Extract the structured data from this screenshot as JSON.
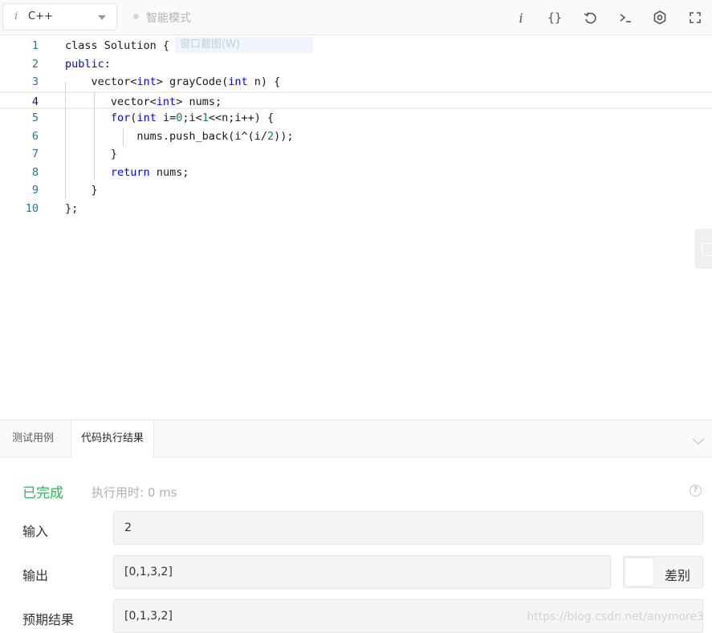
{
  "toolbar": {
    "language": "C++",
    "mode_label": "智能模式",
    "icons": [
      "info-icon",
      "format-braces-icon",
      "reset-icon",
      "console-icon",
      "settings-icon",
      "fullscreen-icon"
    ]
  },
  "editor": {
    "overlay_hint": "窗口截图(W)",
    "current_line": 4,
    "lines": [
      {
        "n": "1",
        "tokens": [
          [
            "",
            "class Solution {"
          ]
        ]
      },
      {
        "n": "2",
        "tokens": [
          [
            "kw",
            "public"
          ],
          [
            "",
            ":"
          ]
        ]
      },
      {
        "n": "3",
        "tokens": [
          [
            "",
            "    vector<"
          ],
          [
            "kw",
            "int"
          ],
          [
            "",
            "> grayCode("
          ],
          [
            "kw",
            "int"
          ],
          [
            "",
            " n) {"
          ]
        ]
      },
      {
        "n": "4",
        "tokens": [
          [
            "",
            "       vector<"
          ],
          [
            "kw",
            "int"
          ],
          [
            "",
            "> nums;"
          ]
        ]
      },
      {
        "n": "5",
        "tokens": [
          [
            "",
            "       "
          ],
          [
            "kw",
            "for"
          ],
          [
            "",
            "("
          ],
          [
            "kw",
            "int"
          ],
          [
            "",
            " i="
          ],
          [
            "nm",
            "0"
          ],
          [
            "",
            ";i<"
          ],
          [
            "nm",
            "1"
          ],
          [
            "",
            "<<n;i++) {"
          ]
        ]
      },
      {
        "n": "6",
        "tokens": [
          [
            "",
            "           nums.push_back(i^(i/"
          ],
          [
            "nm",
            "2"
          ],
          [
            "",
            "));"
          ]
        ]
      },
      {
        "n": "7",
        "tokens": [
          [
            "",
            "       }"
          ]
        ]
      },
      {
        "n": "8",
        "tokens": [
          [
            "",
            "       "
          ],
          [
            "kw",
            "return"
          ],
          [
            "",
            " nums;"
          ]
        ]
      },
      {
        "n": "9",
        "tokens": [
          [
            "",
            "    }"
          ]
        ]
      },
      {
        "n": "10",
        "tokens": [
          [
            "",
            "};"
          ]
        ]
      }
    ]
  },
  "panel": {
    "tabs": [
      "测试用例",
      "代码执行结果"
    ],
    "active_tab": 1,
    "status": "已完成",
    "exec_time": "执行用时: 0 ms",
    "input_label": "输入",
    "input_value": "2",
    "output_label": "输出",
    "output_value": "[0,1,3,2]",
    "diff_label": "差别",
    "expected_label": "预期结果",
    "expected_value": "[0,1,3,2]"
  },
  "watermark": "https://blog.csdn.net/anymore3",
  "colors": {
    "keyword": "#0000ff",
    "number": "#098658",
    "line_number": "#237893",
    "status_success": "#2db55d"
  }
}
